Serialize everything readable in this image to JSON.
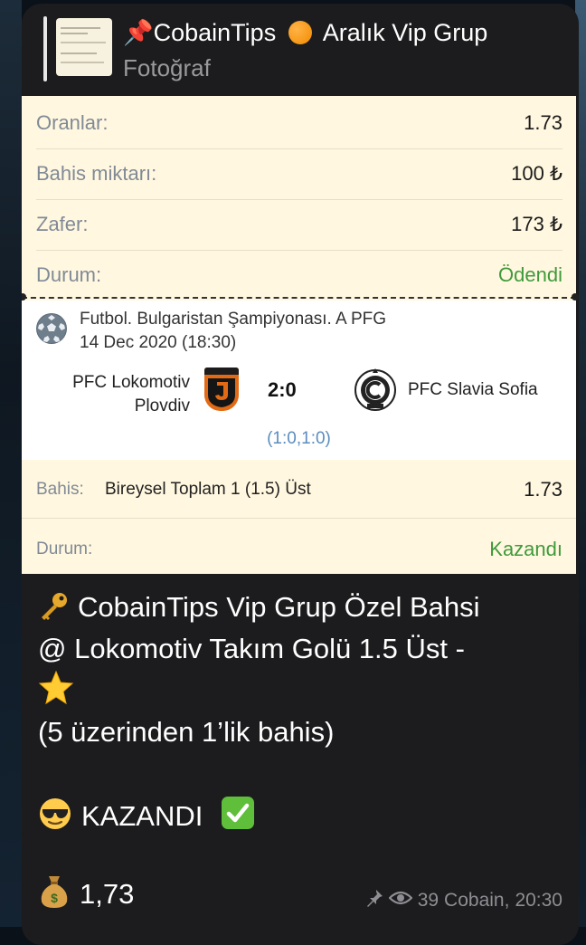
{
  "reply": {
    "title_pin": "📌",
    "title_name": "CobainTips",
    "title_rest": "Aralık Vip Grup",
    "subtitle": "Fotoğraf"
  },
  "summary": {
    "rows": [
      {
        "label": "Oranlar:",
        "value": "1.73",
        "green": false
      },
      {
        "label": "Bahis miktarı:",
        "value": "100 ₺",
        "green": false
      },
      {
        "label": " Zafer:",
        "value": "173 ₺",
        "green": false
      },
      {
        "label": "Durum:",
        "value": "Ödendi",
        "green": true
      }
    ]
  },
  "match": {
    "league": "Futbol. Bulgaristan Şampiyonası. A PFG",
    "datetime": "14 Dec 2020 (18:30)",
    "home_line1": "PFC Lokomotiv",
    "home_line2": "Plovdiv",
    "score": "2:0",
    "away": "PFC Slavia Sofia",
    "halftime": "(1:0,1:0)"
  },
  "bet": {
    "label": "Bahis:",
    "description": "Bireysel Toplam 1 (1.5) Üst",
    "odds": "1.73",
    "status_label": "Durum:",
    "status_value": "Kazandı"
  },
  "message": {
    "line1": "CobainTips Vip Grup Özel Bahsi",
    "line2": "@ Lokomotiv Takım Golü 1.5 Üst -",
    "line4": "(5 üzerinden 1’lik bahis)",
    "result": "KAZANDI",
    "payout": "1,73"
  },
  "footer": {
    "views": "39",
    "author": "Cobain,",
    "time": "20:30"
  },
  "colors": {
    "card_bg": "#fff7df",
    "success_green": "#3f9a3c",
    "link_blue": "#5a8dbf",
    "bubble_bg": "#1c1c1e"
  },
  "icons": [
    "pushpin-icon",
    "orange-circle-icon",
    "soccer-ball-icon",
    "key-emoji",
    "star-emoji",
    "sunglasses-emoji",
    "check-mark-emoji",
    "money-bag-emoji",
    "pin-icon",
    "eye-icon"
  ]
}
